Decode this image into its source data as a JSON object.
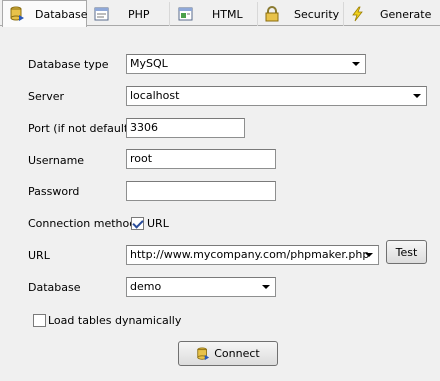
{
  "tabs": [
    {
      "label": "Database",
      "icon": "database-icon",
      "active": true
    },
    {
      "label": "PHP",
      "icon": "php-icon",
      "active": false
    },
    {
      "label": "HTML",
      "icon": "html-icon",
      "active": false
    },
    {
      "label": "Security",
      "icon": "lock-icon",
      "active": false
    },
    {
      "label": "Generate",
      "icon": "lightning-icon",
      "active": false
    }
  ],
  "form": {
    "database_type": {
      "label": "Database type",
      "value": "MySQL"
    },
    "server": {
      "label": "Server",
      "value": "localhost"
    },
    "port": {
      "label": "Port (if not default)",
      "value": "3306"
    },
    "username": {
      "label": "Username",
      "value": "root"
    },
    "password": {
      "label": "Password",
      "value": ""
    },
    "connection_method": {
      "label": "Connection method",
      "checkbox_label": "URL",
      "checked": true
    },
    "url": {
      "label": "URL",
      "value": "http://www.mycompany.com/phpmaker.php"
    },
    "test_button": {
      "label": "Test"
    },
    "database": {
      "label": "Database",
      "value": "demo"
    },
    "load_tables": {
      "label": "Load tables dynamically",
      "checked": false
    },
    "connect_button": {
      "label": "Connect",
      "icon": "database-icon"
    }
  }
}
